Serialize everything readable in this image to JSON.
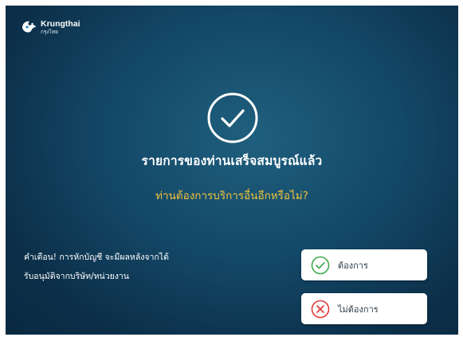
{
  "brand": {
    "name": "Krungthai",
    "sub": "กรุงไทย",
    "icon": "krungthai-bird-logo"
  },
  "status": {
    "icon": "check-circle-icon",
    "title": "รายการของท่านเสร็จสมบูรณ์แล้ว",
    "question": "ท่านต้องการบริการอื่นอีกหรือไม่?"
  },
  "warning": {
    "line1": "คำเตือน! การหักบัญชี จะมีผลหลังจากได้",
    "line2": "รับอนุมัติจากบริษัท/หน่วยงาน"
  },
  "options": {
    "yes": {
      "label": "ต้องการ",
      "icon": "check-circle-icon",
      "color": "#3ea84a"
    },
    "no": {
      "label": "ไม่ต้องการ",
      "icon": "close-circle-icon",
      "color": "#e23a3a"
    }
  },
  "colors": {
    "background": "#134766",
    "question_text": "#f3c53a",
    "button_bg": "#ffffff"
  }
}
